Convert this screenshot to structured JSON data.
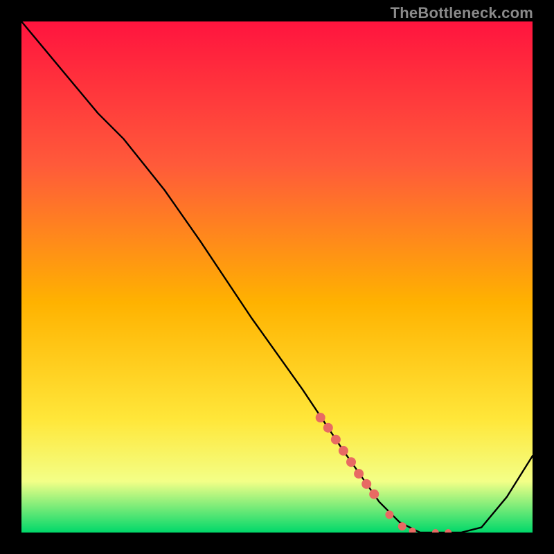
{
  "watermark": "TheBottleneck.com",
  "colors": {
    "frame": "#000000",
    "top": "#ff143e",
    "mid": "#ffd400",
    "bottom": "#00d86a",
    "line": "#000000",
    "marker": "#e86a63"
  },
  "chart_data": {
    "type": "line",
    "title": "",
    "xlabel": "",
    "ylabel": "",
    "xlim": [
      0,
      1
    ],
    "ylim": [
      0,
      1
    ],
    "series": [
      {
        "name": "bottleneck-curve",
        "x": [
          0.0,
          0.05,
          0.1,
          0.15,
          0.2,
          0.24,
          0.28,
          0.35,
          0.45,
          0.55,
          0.63,
          0.7,
          0.74,
          0.78,
          0.82,
          0.86,
          0.9,
          0.95,
          1.0
        ],
        "y": [
          1.0,
          0.94,
          0.88,
          0.82,
          0.77,
          0.72,
          0.67,
          0.57,
          0.42,
          0.28,
          0.16,
          0.06,
          0.02,
          0.0,
          0.0,
          0.0,
          0.01,
          0.07,
          0.15
        ]
      }
    ],
    "markers": {
      "name": "highlight-points",
      "x": [
        0.585,
        0.6,
        0.615,
        0.63,
        0.645,
        0.66,
        0.675,
        0.69,
        0.72,
        0.745,
        0.765,
        0.81,
        0.835
      ],
      "y": [
        0.225,
        0.205,
        0.182,
        0.16,
        0.138,
        0.115,
        0.095,
        0.075,
        0.035,
        0.012,
        0.003,
        0.0,
        0.0
      ],
      "radius": [
        7,
        7,
        7,
        7,
        7,
        7,
        7,
        7,
        6,
        6,
        5,
        5,
        5
      ]
    },
    "legend": []
  }
}
